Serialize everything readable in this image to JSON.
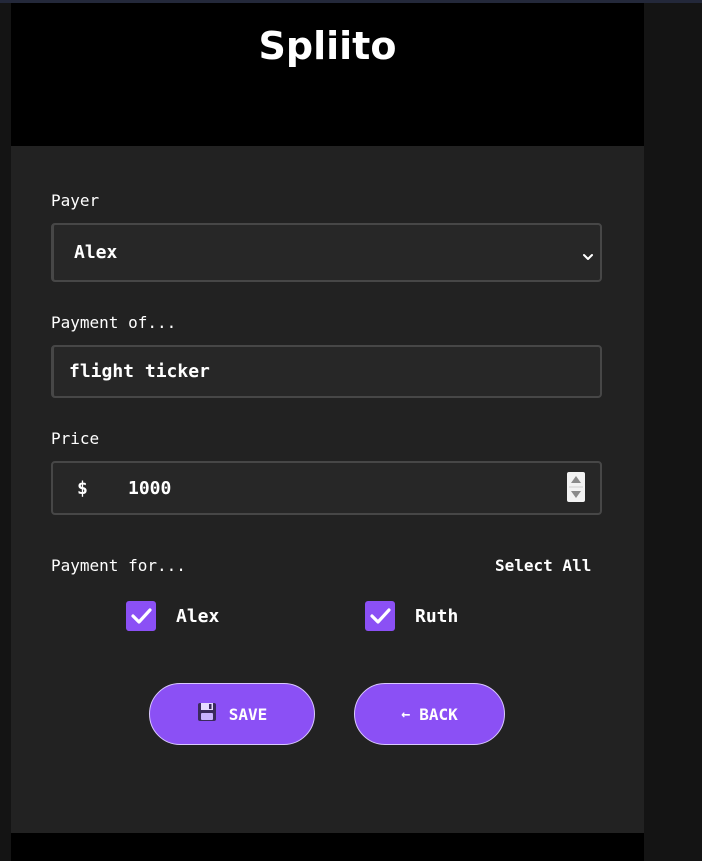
{
  "app": {
    "title": "Spliito"
  },
  "form": {
    "payer": {
      "label": "Payer",
      "value": "Alex"
    },
    "payment_of": {
      "label": "Payment of...",
      "value": "flight ticker"
    },
    "price": {
      "label": "Price",
      "currency": "$",
      "value": "1000"
    },
    "payment_for": {
      "label": "Payment for...",
      "select_all_label": "Select All",
      "members": [
        {
          "name": "Alex",
          "checked": true
        },
        {
          "name": "Ruth",
          "checked": true
        }
      ]
    }
  },
  "actions": {
    "save_label": "SAVE",
    "save_icon": "floppy-disk-icon",
    "back_arrow": "←",
    "back_label": "BACK"
  },
  "colors": {
    "accent": "#8b50f5",
    "card_background": "#222222",
    "header_background": "#000000"
  }
}
